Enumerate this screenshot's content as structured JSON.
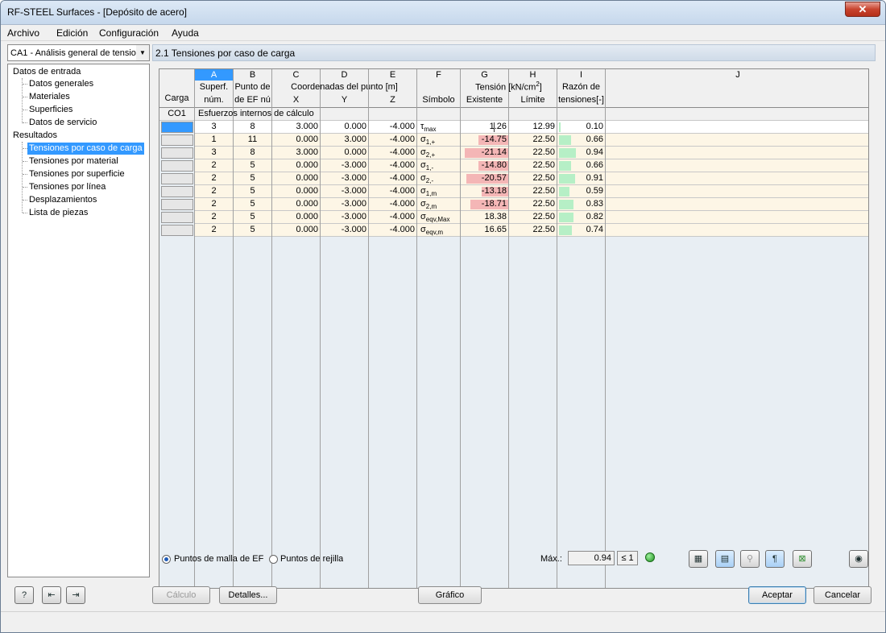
{
  "window": {
    "title": "RF-STEEL Surfaces - [Depósito de acero]",
    "close": "✕"
  },
  "menu": [
    "Archivo",
    "Edición",
    "Configuración",
    "Ayuda"
  ],
  "load_case_select": "CA1 - Análisis general de tensior",
  "tree": {
    "input_header": "Datos de entrada",
    "input_items": [
      "Datos generales",
      "Materiales",
      "Superficies",
      "Datos de servicio"
    ],
    "results_header": "Resultados",
    "result_items": [
      "Tensiones por caso de carga",
      "Tensiones por material",
      "Tensiones por superficie",
      "Tensiones por línea",
      "Desplazamientos",
      "Lista de piezas"
    ]
  },
  "section_title": "2.1 Tensiones por caso de carga",
  "table": {
    "col_letters": [
      "A",
      "B",
      "C",
      "D",
      "E",
      "F",
      "G",
      "H",
      "I",
      "J"
    ],
    "h_carga": "Carga",
    "h_superf1": "Superf.",
    "h_superf2": "núm.",
    "h_punto1": "Punto de",
    "h_punto2": "de EF nú",
    "h_coord": "Coordenadas del punto [m]",
    "h_x": "X",
    "h_y": "Y",
    "h_z": "Z",
    "h_tension": "Tensión [kN/cm",
    "h_tension_sup": "2",
    "h_tension_end": "]",
    "h_simbolo": "Símbolo",
    "h_existente": "Existente",
    "h_limite": "Límite",
    "h_razon1": "Razón de",
    "h_razon2": "tensiones[-]",
    "group_load": "CO1",
    "group_label": "Esfuerzos internos de cálculo",
    "rows": [
      {
        "superf": "3",
        "punto": "8",
        "x": "3.000",
        "y": "0.000",
        "z": "-4.000",
        "sym": "τ",
        "sub": "max",
        "exist": "1.26",
        "limite": "12.99",
        "ratio": "0.10"
      },
      {
        "superf": "1",
        "punto": "11",
        "x": "0.000",
        "y": "3.000",
        "z": "-4.000",
        "sym": "σ",
        "sub": "1,+",
        "exist": "-14.75",
        "limite": "22.50",
        "ratio": "0.66"
      },
      {
        "superf": "3",
        "punto": "8",
        "x": "3.000",
        "y": "0.000",
        "z": "-4.000",
        "sym": "σ",
        "sub": "2,+",
        "exist": "-21.14",
        "limite": "22.50",
        "ratio": "0.94"
      },
      {
        "superf": "2",
        "punto": "5",
        "x": "0.000",
        "y": "-3.000",
        "z": "-4.000",
        "sym": "σ",
        "sub": "1,-",
        "exist": "-14.80",
        "limite": "22.50",
        "ratio": "0.66"
      },
      {
        "superf": "2",
        "punto": "5",
        "x": "0.000",
        "y": "-3.000",
        "z": "-4.000",
        "sym": "σ",
        "sub": "2,-",
        "exist": "-20.57",
        "limite": "22.50",
        "ratio": "0.91"
      },
      {
        "superf": "2",
        "punto": "5",
        "x": "0.000",
        "y": "-3.000",
        "z": "-4.000",
        "sym": "σ",
        "sub": "1,m",
        "exist": "-13.18",
        "limite": "22.50",
        "ratio": "0.59"
      },
      {
        "superf": "2",
        "punto": "5",
        "x": "0.000",
        "y": "-3.000",
        "z": "-4.000",
        "sym": "σ",
        "sub": "2,m",
        "exist": "-18.71",
        "limite": "22.50",
        "ratio": "0.83"
      },
      {
        "superf": "2",
        "punto": "5",
        "x": "0.000",
        "y": "-3.000",
        "z": "-4.000",
        "sym": "σ",
        "sub": "eqv,Max",
        "exist": "18.38",
        "limite": "22.50",
        "ratio": "0.82"
      },
      {
        "superf": "2",
        "punto": "5",
        "x": "0.000",
        "y": "-3.000",
        "z": "-4.000",
        "sym": "σ",
        "sub": "eqv,m",
        "exist": "16.65",
        "limite": "22.50",
        "ratio": "0.74"
      }
    ]
  },
  "options": {
    "radio1": "Puntos de malla de EF",
    "radio2": "Puntos de rejilla",
    "max_label": "Máx.:",
    "max_value": "0.94",
    "le1": "≤ 1"
  },
  "buttons": {
    "calculo": "Cálculo",
    "detalles": "Detalles...",
    "grafico": "Gráfico",
    "aceptar": "Aceptar",
    "cancelar": "Cancelar"
  },
  "colors": {
    "negative_bar": "#f4b6b6",
    "ratio_bar": "#b6efc6",
    "selected_tree": "#3399ff",
    "header_active": "#3399ff"
  }
}
